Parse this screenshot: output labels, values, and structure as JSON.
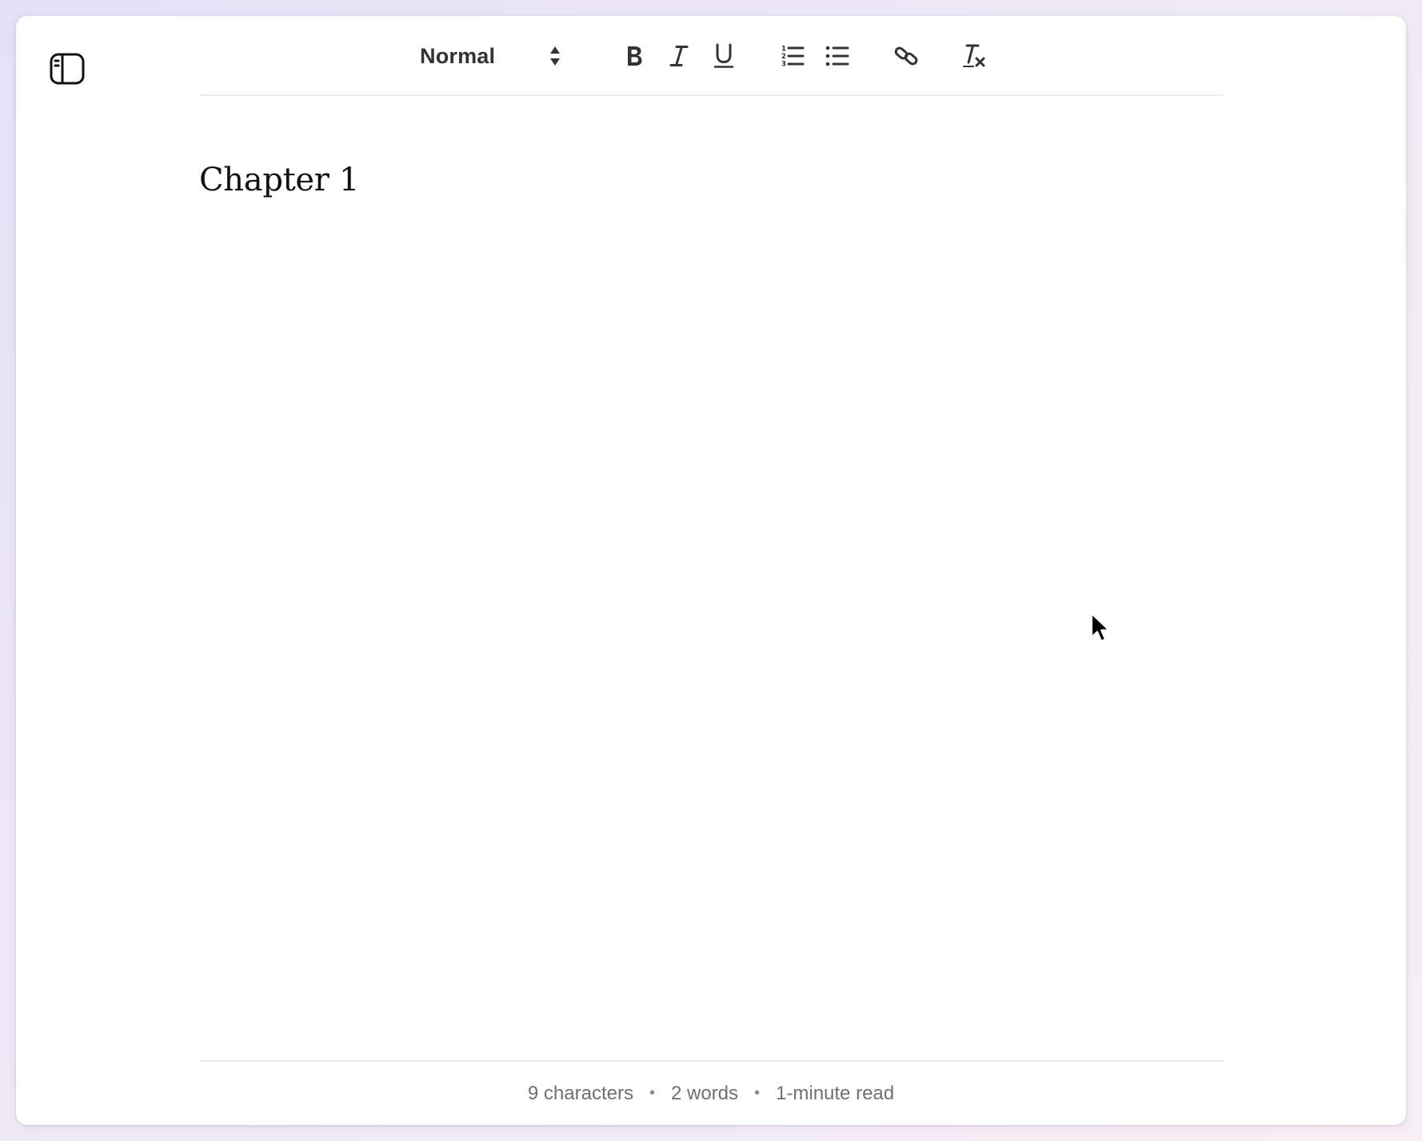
{
  "sidebar": {
    "toggle_icon": "sidebar-toggle-icon"
  },
  "toolbar": {
    "format_select": {
      "value": "Normal",
      "icon": "updown-arrows-icon"
    },
    "tools": [
      {
        "name": "bold",
        "icon": "bold-icon"
      },
      {
        "name": "italic",
        "icon": "italic-icon"
      },
      {
        "name": "underline",
        "icon": "underline-icon"
      },
      {
        "name": "ordered-list",
        "icon": "ordered-list-icon"
      },
      {
        "name": "bullet-list",
        "icon": "bullet-list-icon"
      },
      {
        "name": "link",
        "icon": "link-icon"
      },
      {
        "name": "clear-formatting",
        "icon": "clear-format-icon"
      }
    ]
  },
  "document": {
    "heading": "Chapter 1"
  },
  "status": {
    "characters": "9 characters",
    "words": "2 words",
    "read_time": "1-minute read",
    "separator": "•"
  },
  "colors": {
    "icon": "#333333",
    "divider": "#ececec",
    "status_text": "#707070",
    "background_gradient_start": "#e4e1f7",
    "background_gradient_end": "#f6eef3"
  }
}
